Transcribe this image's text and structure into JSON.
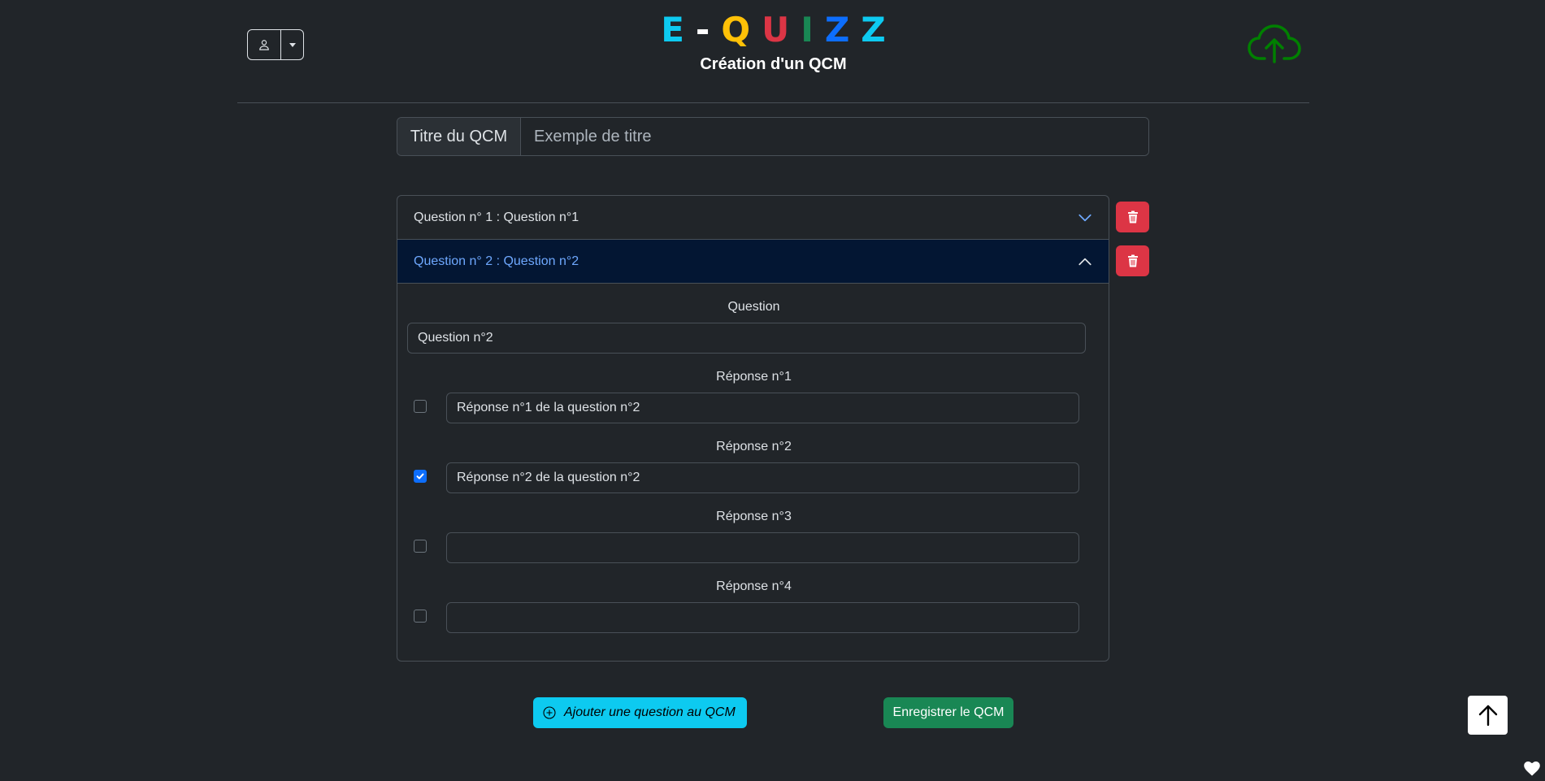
{
  "header": {
    "brand_letters": [
      {
        "char": "E",
        "color": "#0dcaf0"
      },
      {
        "char": "-",
        "color": "#ffffff"
      },
      {
        "char": "Q",
        "color": "#ffc107"
      },
      {
        "char": "U",
        "color": "#dc3545"
      },
      {
        "char": "I",
        "color": "#198754"
      },
      {
        "char": "Z",
        "color": "#0d6efd"
      },
      {
        "char": "Z",
        "color": "#0dcaf0"
      }
    ],
    "subtitle": "Création d'un QCM",
    "user_icon": "person-icon",
    "upload_icon": "cloud-upload-icon",
    "upload_color": "#008000"
  },
  "title_field": {
    "label": "Titre du QCM",
    "placeholder": "Exemple de titre",
    "value": ""
  },
  "questions": [
    {
      "header": "Question n° 1 : Question n°1",
      "expanded": false
    },
    {
      "header": "Question n° 2 : Question n°2",
      "expanded": true,
      "question_label": "Question",
      "question_value": "Question n°2",
      "answers": [
        {
          "label": "Réponse n°1",
          "value": "Réponse n°1 de la question n°2",
          "checked": false
        },
        {
          "label": "Réponse n°2",
          "value": "Réponse n°2 de la question n°2",
          "checked": true
        },
        {
          "label": "Réponse n°3",
          "value": "",
          "checked": false
        },
        {
          "label": "Réponse n°4",
          "value": "",
          "checked": false
        }
      ]
    }
  ],
  "actions": {
    "add_question": "Ajouter une question au QCM",
    "save": "Enregistrer le QCM"
  },
  "colors": {
    "background": "#212529",
    "danger": "#dc3545",
    "info": "#0dcaf0",
    "success": "#198754",
    "accordion_active_bg": "#031633",
    "accordion_active_text": "#6ea8fe"
  }
}
